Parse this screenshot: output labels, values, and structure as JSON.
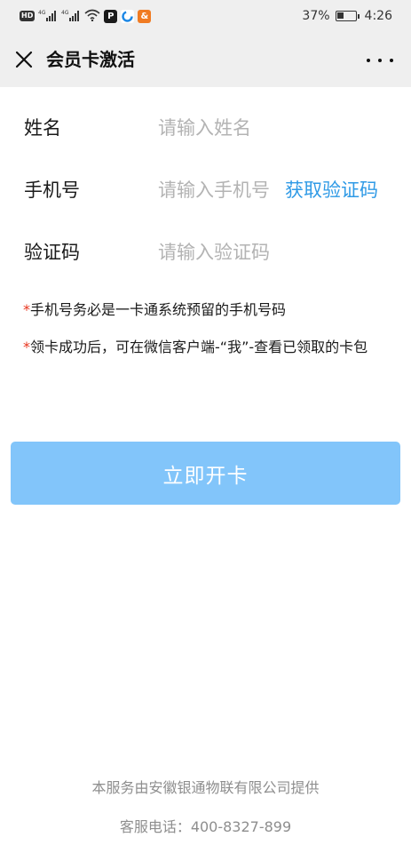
{
  "status_bar": {
    "hd_label": "HD",
    "network_1": "4G",
    "network_2": "4G",
    "app_icon_1": "P",
    "app_icon_3": "&",
    "battery_percent": "37%",
    "battery_level": 0.37,
    "time": "4:26",
    "icons": [
      "hd-icon",
      "signal-icon",
      "signal-icon",
      "wifi-icon",
      "app-icon",
      "app-icon",
      "app-icon",
      "battery-icon"
    ]
  },
  "header": {
    "title": "会员卡激活",
    "close_icon": "close-icon",
    "more_icon": "more-icon"
  },
  "form": {
    "name": {
      "label": "姓名",
      "placeholder": "请输入姓名",
      "value": ""
    },
    "phone": {
      "label": "手机号",
      "placeholder": "请输入手机号",
      "value": "",
      "code_button": "获取验证码"
    },
    "code": {
      "label": "验证码",
      "placeholder": "请输入验证码",
      "value": ""
    }
  },
  "notes": {
    "note1_star": "*",
    "note1": "手机号务必是一卡通系统预留的手机号码",
    "note2_star": "*",
    "note2": "领卡成功后，可在微信客户端-“我”-查看已领取的卡包"
  },
  "submit": {
    "label": "立即开卡"
  },
  "footer": {
    "provider": "本服务由安徽银通物联有限公司提供",
    "hotline": "客服电话：400-8327-899"
  },
  "colors": {
    "accent": "#2f9ae6",
    "button": "#82c5fa",
    "required": "#e8351e",
    "header_bg": "#efefef"
  }
}
